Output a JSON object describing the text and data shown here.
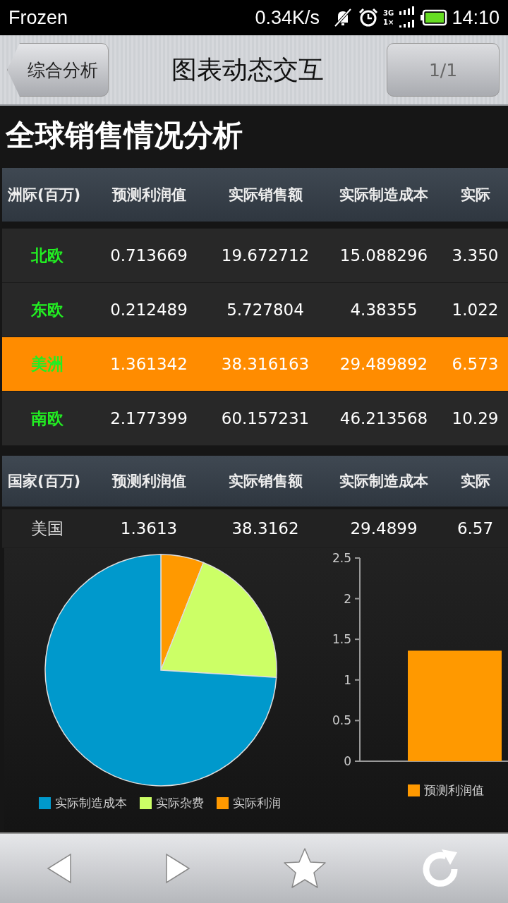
{
  "status_bar": {
    "app": "Frozen",
    "speed": "0.34K/s",
    "network_top": "3G",
    "network_bottom": "1×",
    "time": "14:10"
  },
  "nav": {
    "back": "综合分析",
    "title": "图表动态交互",
    "page": "1/1"
  },
  "heading": "全球销售情况分析",
  "region_table": {
    "columns": [
      "洲际(百万)",
      "预测利润值",
      "实际销售额",
      "实际制造成本",
      "实际"
    ],
    "rows": [
      {
        "cells": [
          "北欧",
          "0.713669",
          "19.672712",
          "15.088296",
          "3.350"
        ],
        "selected": false
      },
      {
        "cells": [
          "东欧",
          "0.212489",
          "5.727804",
          "4.38355",
          "1.022"
        ],
        "selected": false
      },
      {
        "cells": [
          "美洲",
          "1.361342",
          "38.316163",
          "29.489892",
          "6.573"
        ],
        "selected": true
      },
      {
        "cells": [
          "南欧",
          "2.177399",
          "60.157231",
          "46.213568",
          "10.29"
        ],
        "selected": false
      }
    ]
  },
  "country_table": {
    "columns": [
      "国家(百万)",
      "预测利润值",
      "实际销售额",
      "实际制造成本",
      "实际"
    ],
    "rows": [
      {
        "cells": [
          "美国",
          "1.3613",
          "38.3162",
          "29.4899",
          "6.57"
        ]
      }
    ]
  },
  "pie": {
    "legend": [
      {
        "label": "实际制造成本",
        "color": "#0099cc"
      },
      {
        "label": "实际杂费",
        "color": "#ccff66"
      },
      {
        "label": "实际利润",
        "color": "#ff9900"
      }
    ]
  },
  "bar": {
    "chart_data": {
      "type": "bar",
      "ylim": [
        0,
        2.5
      ],
      "yticks": [
        0,
        0.5,
        1,
        1.5,
        2,
        2.5
      ],
      "series": [
        {
          "name": "预测利润值",
          "color": "#ff9900",
          "values": [
            1.36
          ]
        }
      ]
    }
  }
}
